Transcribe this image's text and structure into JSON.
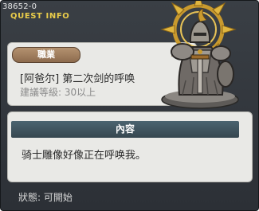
{
  "window": {
    "quest_id": "38652-0",
    "header_title": "QUEST INFO"
  },
  "quest": {
    "job_label": "職業",
    "title": "[阿爸尔] 第二次剑的呼唤",
    "level_text": "建議等級: 30以上"
  },
  "content": {
    "header": "內容",
    "text": "骑士雕像好像正在呼唤我。"
  },
  "status": {
    "text": "狀態:  可開始"
  },
  "colors": {
    "title_gold": "#e9cc4a",
    "job_badge": "#a5825f",
    "content_header": "#3e525c"
  },
  "icons": {
    "portrait": "knight-statue-icon"
  }
}
